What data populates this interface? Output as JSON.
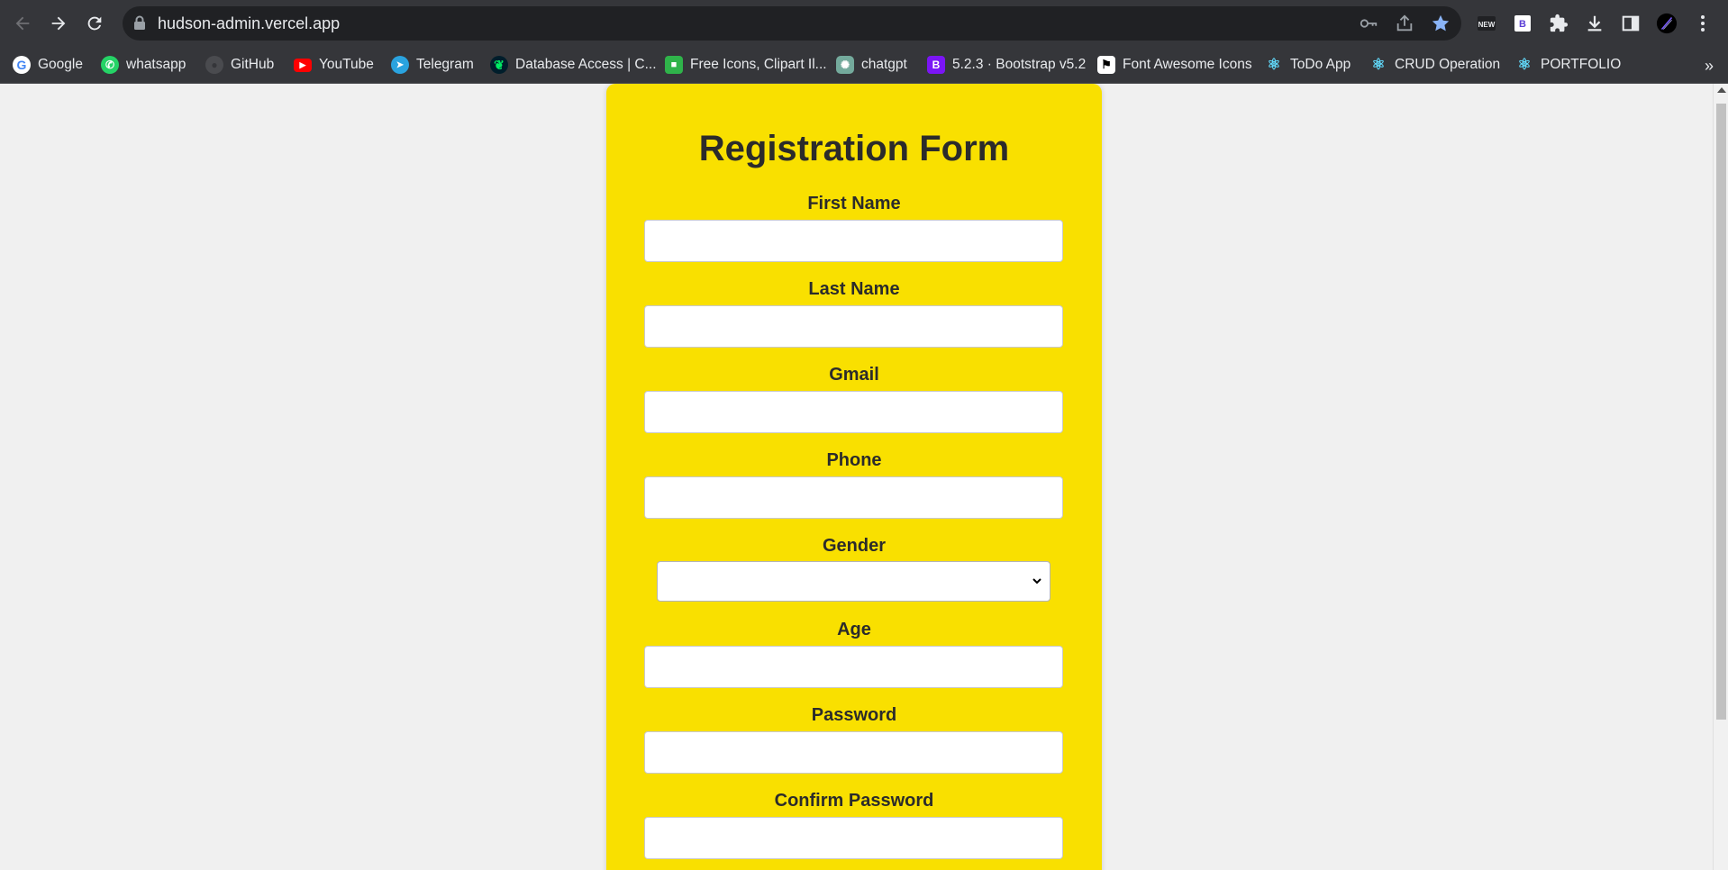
{
  "browser": {
    "url": "hudson-admin.vercel.app",
    "accent": "#8ab4f8"
  },
  "bookmarks": [
    {
      "label": "Google",
      "icon": "google-icon",
      "color": "#ffffff"
    },
    {
      "label": "whatsapp",
      "icon": "whatsapp-icon",
      "color": "#25d366"
    },
    {
      "label": "GitHub",
      "icon": "github-icon",
      "color": "#4a4b4f"
    },
    {
      "label": "YouTube",
      "icon": "youtube-icon",
      "color": "#ff0000"
    },
    {
      "label": "Telegram",
      "icon": "telegram-icon",
      "color": "#2aa3df"
    },
    {
      "label": "Database Access | C...",
      "icon": "mongodb-icon",
      "color": "#00684a"
    },
    {
      "label": "Free Icons, Clipart Il...",
      "icon": "icons8-icon",
      "color": "#2fb34a"
    },
    {
      "label": "chatgpt",
      "icon": "chatgpt-icon",
      "color": "#74aa9c"
    },
    {
      "label": "5.2.3 · Bootstrap v5.2",
      "icon": "bootstrap-icon",
      "color": "#7b15f5"
    },
    {
      "label": "Font Awesome Icons",
      "icon": "font-awesome-flag-icon",
      "color": "#ffffff"
    },
    {
      "label": "ToDo App",
      "icon": "react-icon",
      "color": "#61dafb"
    },
    {
      "label": "CRUD Operation",
      "icon": "react-icon",
      "color": "#61dafb"
    },
    {
      "label": "PORTFOLIO",
      "icon": "react-icon",
      "color": "#61dafb"
    }
  ],
  "form": {
    "title": "Registration Form",
    "background": "#f9e000",
    "fields": {
      "first_name": "First Name",
      "last_name": "Last Name",
      "gmail": "Gmail",
      "phone": "Phone",
      "gender": "Gender",
      "age": "Age",
      "password": "Password",
      "confirm_password": "Confirm Password"
    }
  }
}
